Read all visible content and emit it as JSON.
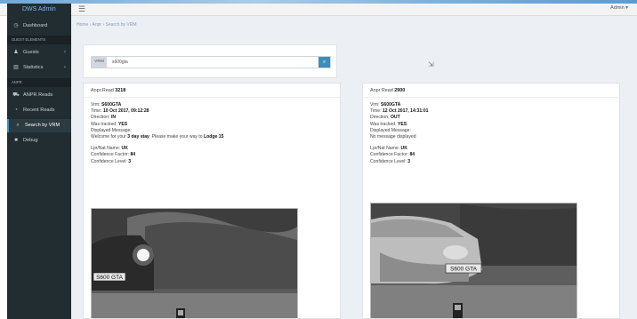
{
  "app": {
    "brand": "DWS Admin",
    "menu_toggle": "☰",
    "user_menu": "Admin ▾"
  },
  "breadcrumb": "Home › Anpr › Search by VRM",
  "sidebar": {
    "items": [
      {
        "label": "Dashboard",
        "icon": "dashboard-icon",
        "glyph": "◷"
      },
      {
        "header": "GUEST ELEMENTS"
      },
      {
        "label": "Guests",
        "icon": "user-icon",
        "glyph": "♟",
        "chevron": "‹"
      },
      {
        "label": "Statistics",
        "icon": "bar-chart-icon",
        "glyph": "▥",
        "chevron": "‹"
      },
      {
        "header": "ANPR"
      },
      {
        "label": "ANPR Reads",
        "icon": "car-icon",
        "glyph": "⛟"
      },
      {
        "label": "Recent Reads",
        "icon": "clock-icon",
        "glyph": "◔"
      },
      {
        "label": "Search by VRM",
        "icon": "search-icon",
        "glyph": "⌕",
        "active": true
      },
      {
        "label": "Debug",
        "icon": "bug-icon",
        "glyph": "■"
      }
    ]
  },
  "search": {
    "type_label": "VRM",
    "value": "s600gta",
    "button_icon": "search-icon",
    "button_glyph": "⌕"
  },
  "cursor_glyph": "⇲",
  "reads": [
    {
      "title_prefix": "Anpr Read",
      "read_id": "3218",
      "vrm_label": "Vrm:",
      "vrm": "S600GTA",
      "time_label": "Time:",
      "time": "10 Oct 2017, 09:12:28",
      "direction_label": "Direction:",
      "direction": "IN",
      "was_tracked_label": "Was tracked:",
      "was_tracked": "YES",
      "displayed_label": "Displayed Message:",
      "message_pre": "Welcome for your",
      "message_bold1": "3 day stay",
      "message_mid": ". Please make your way to",
      "message_bold2": "Lodge 15",
      "plate_country_label": "Lpr/Nat Name:",
      "plate_country": "UK",
      "conf_factor_label": "Confidence Factor:",
      "conf_factor": "84",
      "conf_level_label": "Confidence Level:",
      "conf_level": "3",
      "photo_plate": "S600 GTA"
    },
    {
      "title_prefix": "Anpr Read",
      "read_id": "2900",
      "vrm_label": "Vrm:",
      "vrm": "S600GTA",
      "time_label": "Time:",
      "time": "12 Oct 2017, 14:31:01",
      "direction_label": "Direction:",
      "direction": "OUT",
      "was_tracked_label": "Was tracked:",
      "was_tracked": "YES",
      "displayed_label": "Displayed Message:",
      "message_pre": "No message displayed",
      "message_bold1": "",
      "message_mid": "",
      "message_bold2": "",
      "plate_country_label": "Lpr/Nat Name:",
      "plate_country": "UK",
      "conf_factor_label": "Confidence Factor:",
      "conf_factor": "84",
      "conf_level_label": "Confidence Level:",
      "conf_level": "3",
      "photo_plate": "S600 GTA"
    }
  ]
}
